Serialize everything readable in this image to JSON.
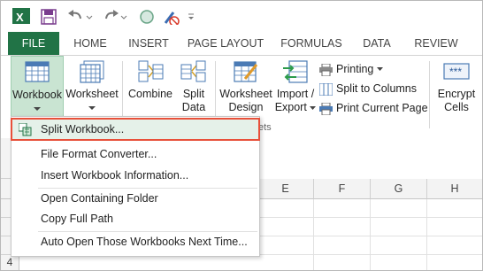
{
  "tabs": [
    "FILE",
    "HOME",
    "INSERT",
    "PAGE LAYOUT",
    "FORMULAS",
    "DATA",
    "REVIEW"
  ],
  "ribbon": {
    "workbook": "Workbook",
    "worksheet": "Worksheet",
    "combine": "Combine",
    "split_data_1": "Split",
    "split_data_2": "Data",
    "ws_design_1": "Worksheet",
    "ws_design_2": "Design",
    "import_export_1": "Import /",
    "import_export_2": "Export",
    "printing": "Printing",
    "split_to_columns": "Split to Columns",
    "print_current_page": "Print Current Page",
    "encrypt_1": "Encrypt",
    "encrypt_2": "Cells",
    "group_label_fragment": "ets"
  },
  "columns": [
    "E",
    "F",
    "G",
    "H"
  ],
  "rows": [
    "4"
  ],
  "menu": {
    "items": [
      "Split Workbook...",
      "File Format Converter...",
      "Insert Workbook Information...",
      "Open Containing Folder",
      "Copy Full Path",
      "Auto Open Those Workbooks Next Time..."
    ]
  },
  "colors": {
    "excel_green": "#217346",
    "selected_button": "#c9e4d2",
    "highlight_border": "#e8503a"
  }
}
